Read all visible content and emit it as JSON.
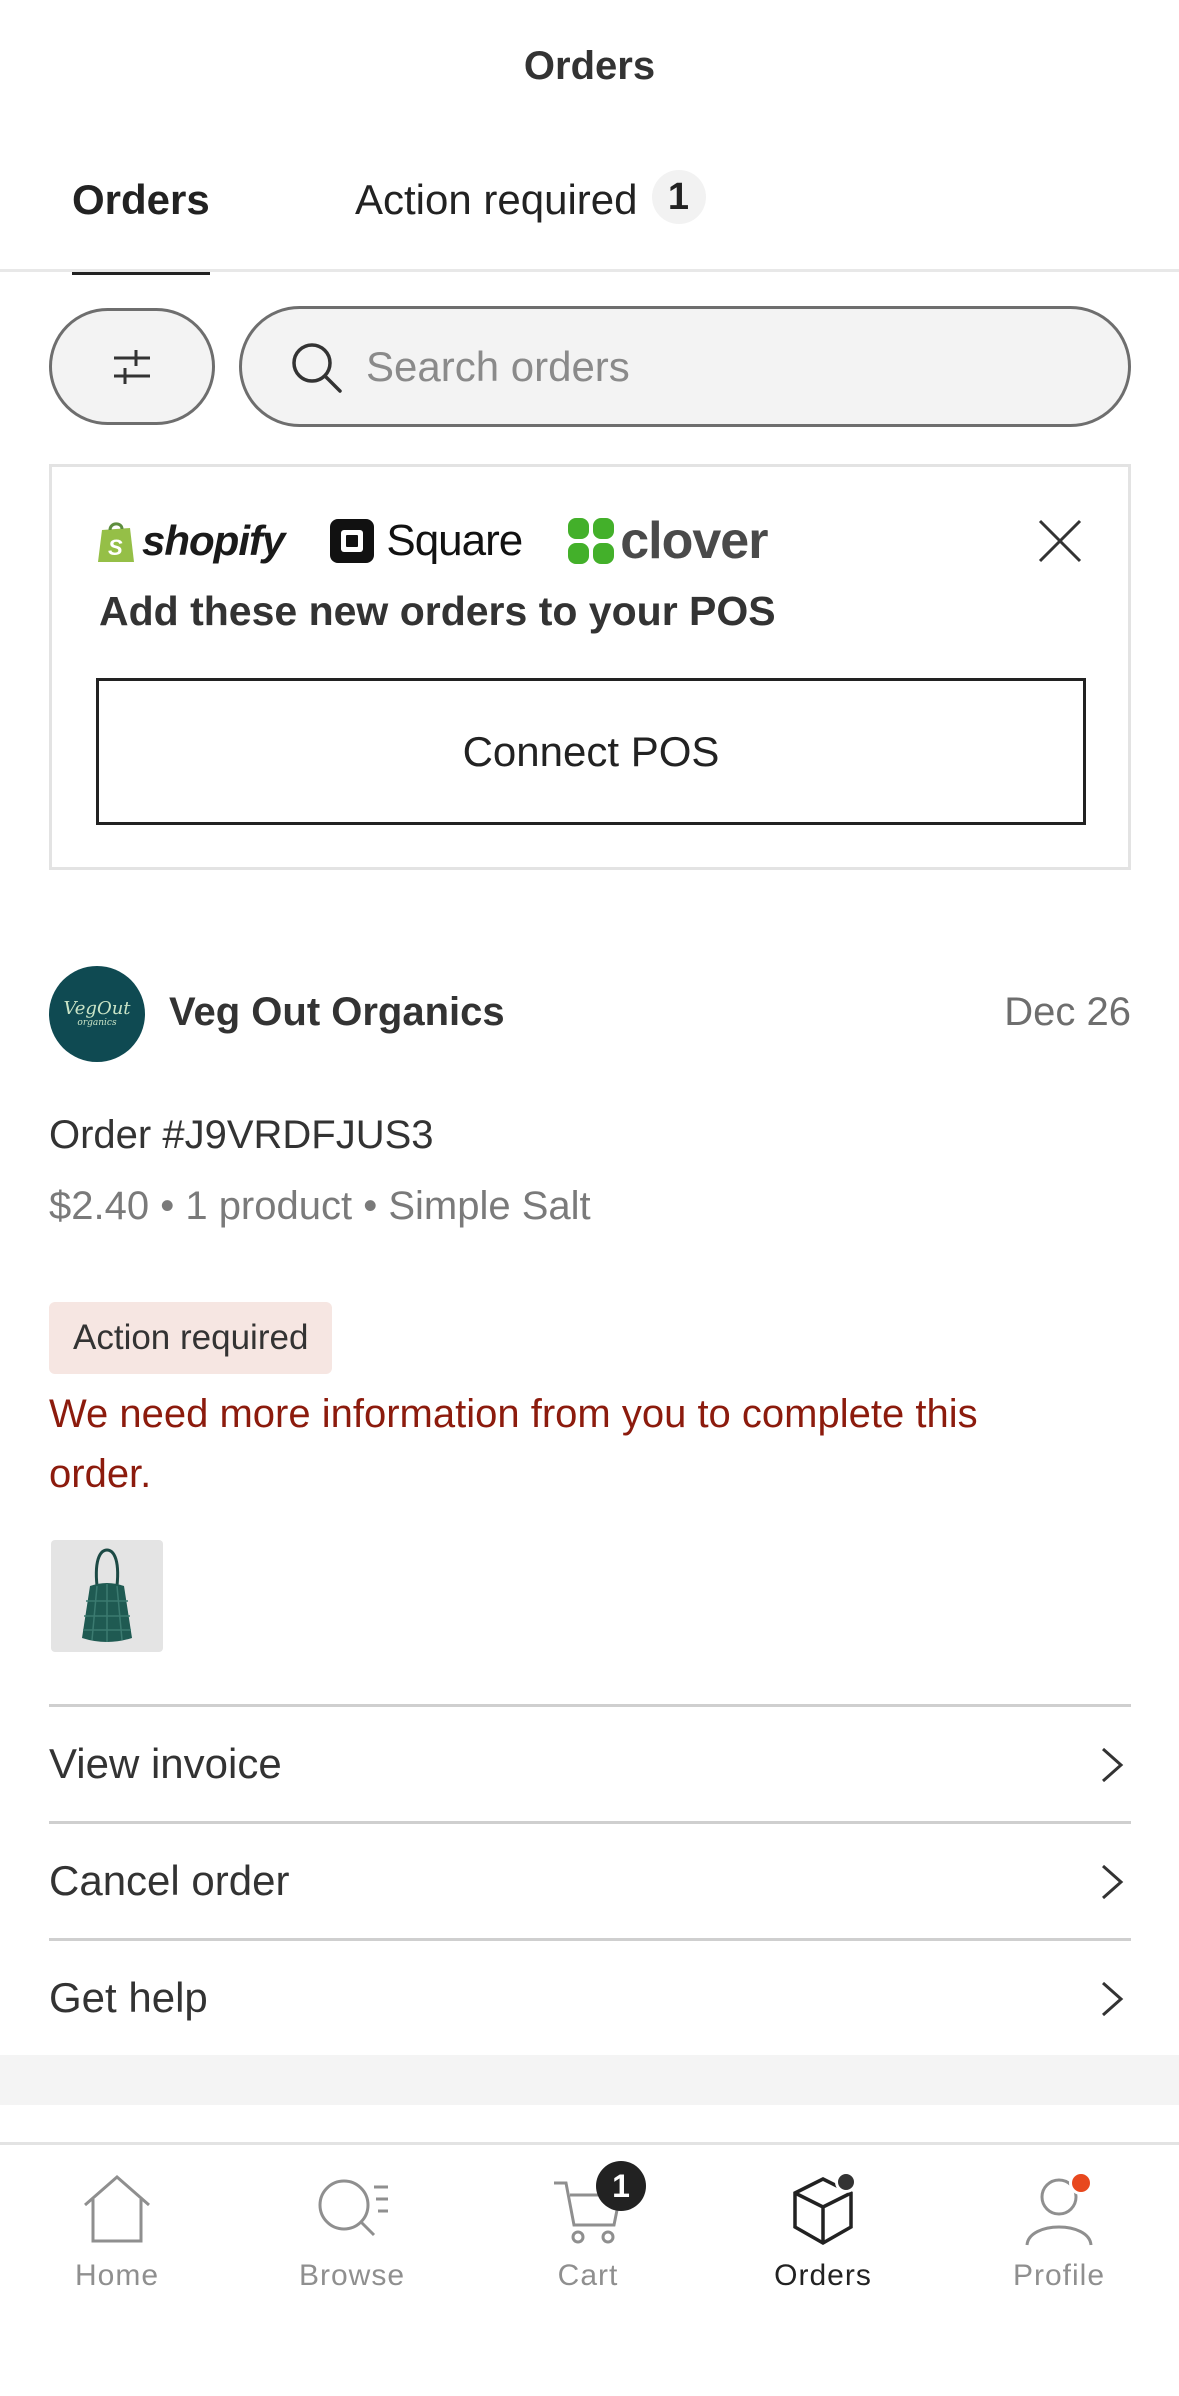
{
  "header": {
    "title": "Orders"
  },
  "tabs": [
    {
      "label": "Orders",
      "active": true
    },
    {
      "label": "Action required",
      "count": "1"
    }
  ],
  "search": {
    "placeholder": "Search orders",
    "value": ""
  },
  "pos_banner": {
    "logos": [
      "shopify",
      "Square",
      "clover"
    ],
    "headline": "Add these new orders to your POS",
    "button": "Connect POS"
  },
  "order": {
    "merchant": "Veg Out Organics",
    "avatar_text": "VegOut",
    "avatar_subtext": "organics",
    "date": "Dec 26",
    "order_number": "Order #J9VRDFJUS3",
    "summary": "$2.40 • 1 product • Simple Salt",
    "badge": "Action required",
    "warning": "We need more information from you to complete this order."
  },
  "links": [
    {
      "label": "View invoice"
    },
    {
      "label": "Cancel order"
    },
    {
      "label": "Get help"
    }
  ],
  "bottom_nav": [
    {
      "label": "Home",
      "icon": "home-icon"
    },
    {
      "label": "Browse",
      "icon": "browse-icon"
    },
    {
      "label": "Cart",
      "icon": "cart-icon",
      "badge": "1"
    },
    {
      "label": "Orders",
      "icon": "orders-icon",
      "active": true
    },
    {
      "label": "Profile",
      "icon": "profile-icon"
    }
  ],
  "colors": {
    "accent_dark": "#222222",
    "warning_text": "#8c1b0d",
    "badge_bg": "#f6e6e2",
    "notification_dot": "#e8481e",
    "shopify_green": "#95bf47",
    "clover_green": "#43b02a",
    "avatar_bg": "#0f4a52"
  }
}
